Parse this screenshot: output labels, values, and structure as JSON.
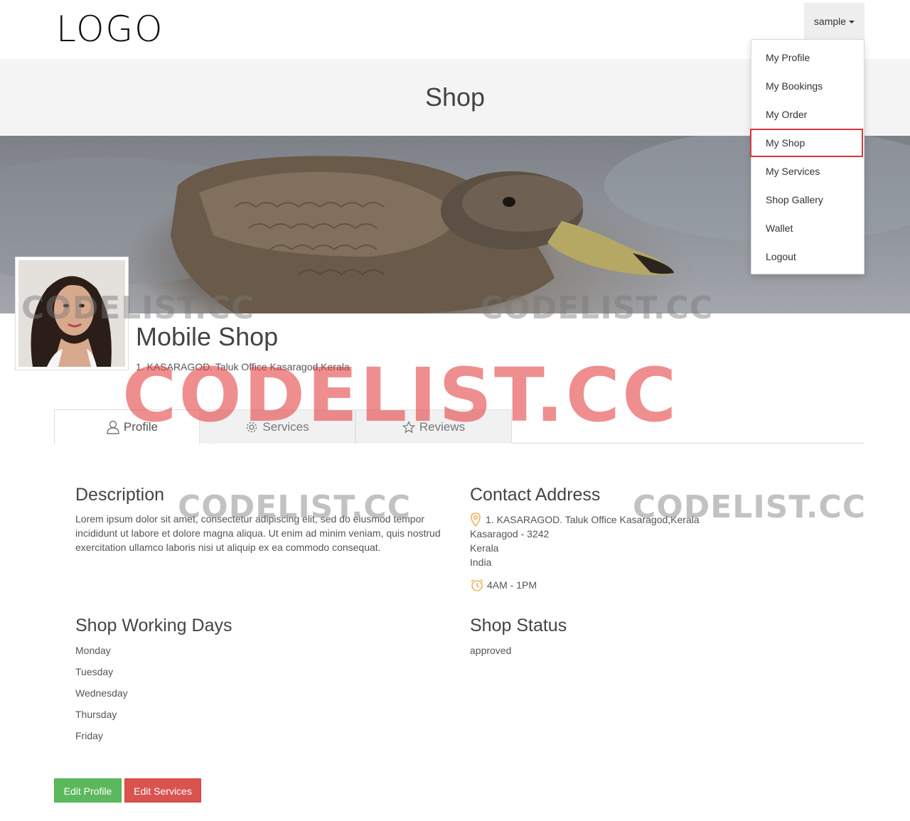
{
  "header": {
    "logo": "LOGO",
    "user_menu_label": "sample"
  },
  "dropdown": {
    "items": [
      {
        "label": "My Profile"
      },
      {
        "label": "My Bookings"
      },
      {
        "label": "My Order"
      },
      {
        "label": "My Shop"
      },
      {
        "label": "My Services"
      },
      {
        "label": "Shop Gallery"
      },
      {
        "label": "Wallet"
      },
      {
        "label": "Logout"
      }
    ],
    "highlighted": "My Shop",
    "highlight_color": "#d9363e"
  },
  "page": {
    "title": "Shop"
  },
  "shop": {
    "name": "Mobile Shop",
    "address_line": "1. KASARAGOD. Taluk Office Kasaragod,Kerala"
  },
  "tabs": [
    {
      "label": "Profile",
      "icon": "user-icon",
      "active": true
    },
    {
      "label": "Services",
      "icon": "gear-icon",
      "active": false
    },
    {
      "label": "Reviews",
      "icon": "star-icon",
      "active": false
    }
  ],
  "description": {
    "title": "Description",
    "text": "Lorem ipsum dolor sit amet, consectetur adipiscing elit, sed do eiusmod tempor incididunt ut labore et dolore magna aliqua. Ut enim ad minim veniam, quis nostrud exercitation ullamco laboris nisi ut aliquip ex ea commodo consequat."
  },
  "contact": {
    "title": "Contact Address",
    "address": "1. KASARAGOD. Taluk Office Kasaragod,Kerala",
    "city_pin": "Kasaragod - 3242",
    "state": "Kerala",
    "country": "India",
    "hours": "4AM - 1PM",
    "icon_color": "#f0a040"
  },
  "working_days": {
    "title": "Shop Working Days",
    "days": [
      "Monday",
      "Tuesday",
      "Wednesday",
      "Thursday",
      "Friday"
    ]
  },
  "status": {
    "title": "Shop Status",
    "value": "approved"
  },
  "buttons": {
    "edit_profile": "Edit Profile",
    "edit_services": "Edit Services"
  },
  "watermark": {
    "text": "CODELIST.CC"
  },
  "colors": {
    "green_button": "#5cb85c",
    "red_button": "#d9534f"
  }
}
